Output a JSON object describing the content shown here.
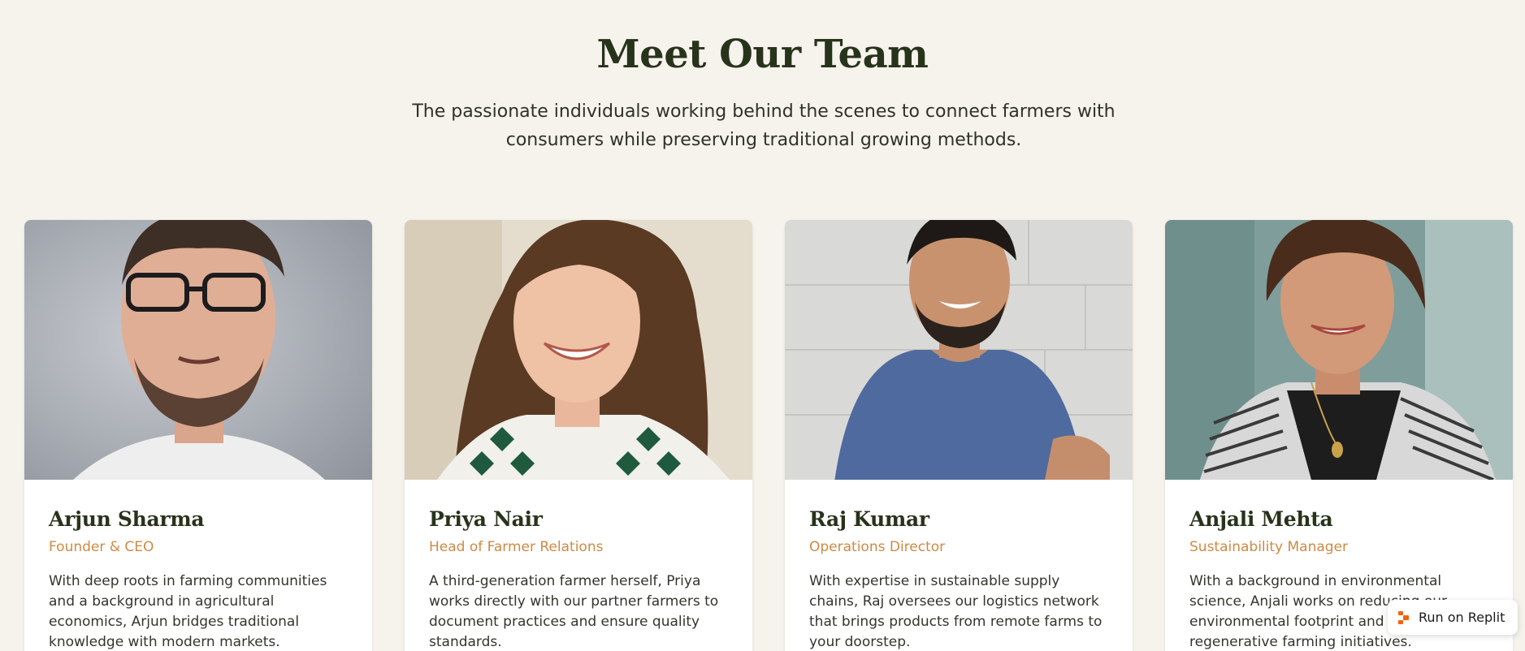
{
  "header": {
    "title": "Meet Our Team",
    "subtitle": "The passionate individuals working behind the scenes to connect farmers with consumers while preserving traditional growing methods."
  },
  "team": [
    {
      "name": "Arjun Sharma",
      "role": "Founder & CEO",
      "bio": "With deep roots in farming communities and a background in agricultural economics, Arjun bridges traditional knowledge with modern markets."
    },
    {
      "name": "Priya Nair",
      "role": "Head of Farmer Relations",
      "bio": "A third-generation farmer herself, Priya works directly with our partner farmers to document practices and ensure quality standards."
    },
    {
      "name": "Raj Kumar",
      "role": "Operations Director",
      "bio": "With expertise in sustainable supply chains, Raj oversees our logistics network that brings products from remote farms to your doorstep."
    },
    {
      "name": "Anjali Mehta",
      "role": "Sustainability Manager",
      "bio": "With a background in environmental science, Anjali works on reducing our environmental footprint and developing regenerative farming initiatives."
    }
  ],
  "badge": {
    "label": "Run on Replit",
    "icon": "replit-logo-icon",
    "color": "#f26207"
  },
  "colors": {
    "background": "#f5f3ec",
    "heading": "#28331b",
    "accent": "#cd8a45"
  }
}
